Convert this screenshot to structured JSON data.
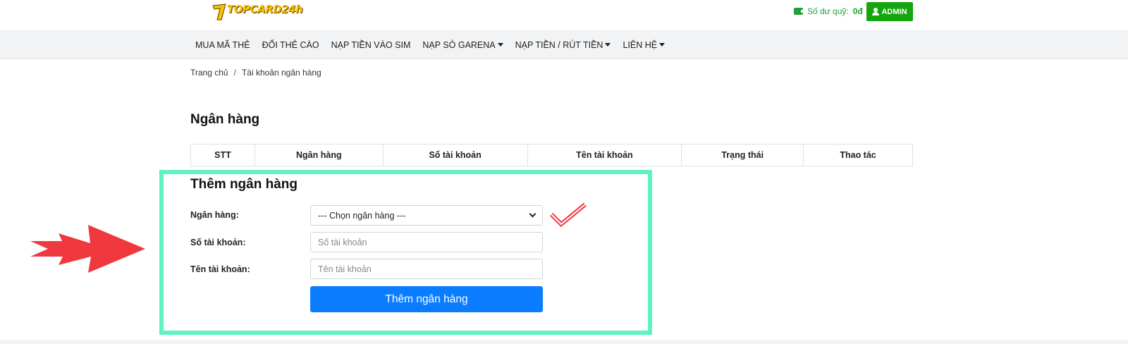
{
  "header": {
    "logo_text": "TOPCARD24h",
    "balance_label": "Số dư quỹ:",
    "balance_value": "0đ",
    "admin_label": "ADMIN"
  },
  "nav": {
    "items": [
      {
        "label": "MUA MÃ THẺ",
        "dropdown": false
      },
      {
        "label": "ĐỔI THẺ CÀO",
        "dropdown": false
      },
      {
        "label": "NẠP TIỀN VÀO SIM",
        "dropdown": false
      },
      {
        "label": "NẠP SÒ GARENA",
        "dropdown": true
      },
      {
        "label": "NẠP TIỀN / RÚT TIỀN",
        "dropdown": true
      },
      {
        "label": "LIÊN HỆ",
        "dropdown": true
      }
    ]
  },
  "breadcrumb": {
    "home": "Trang chủ",
    "separator": "/",
    "current": "Tài khoản ngân hàng"
  },
  "page_title": "Ngân hàng",
  "table": {
    "columns": [
      "STT",
      "Ngân hàng",
      "Số tài khoản",
      "Tên tài khoản",
      "Trạng thái",
      "Thao tác"
    ]
  },
  "add_form": {
    "title": "Thêm ngân hàng",
    "bank_label": "Ngân hàng:",
    "bank_select_value": "--- Chọn ngân hàng ---",
    "account_number_label": "Số tài khoản:",
    "account_number_placeholder": "Số tài khoản",
    "account_name_label": "Tên tài khoản:",
    "account_name_placeholder": "Tên tài khoản",
    "submit_label": "Thêm ngân hàng"
  },
  "colors": {
    "accent_green": "#15a50c",
    "primary_blue": "#0a7cff",
    "highlight_frame": "#5ff2c4",
    "annotation_red": "#f0393f"
  },
  "icons": {
    "wallet": "wallet-icon",
    "user": "user-icon",
    "caret": "caret-down-icon",
    "chevron": "chevron-down-icon",
    "checkmark": "check-annotation-icon",
    "arrow": "arrow-annotation-icon"
  }
}
